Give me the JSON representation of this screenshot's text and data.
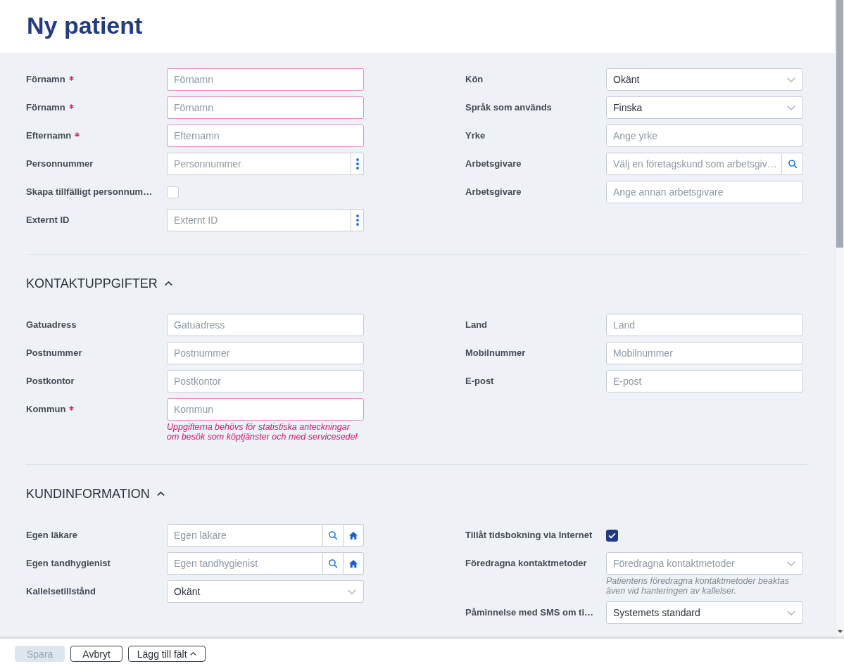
{
  "page": {
    "title": "Ny patient"
  },
  "sections": [
    {
      "left": [
        {
          "kind": "text",
          "label": "Förnamn",
          "required": true,
          "invalid": true,
          "placeholder": "Förnamn"
        },
        {
          "kind": "text",
          "label": "Förnamn",
          "required": true,
          "invalid": true,
          "placeholder": "Förnamn"
        },
        {
          "kind": "text",
          "label": "Efternamn",
          "required": true,
          "invalid": true,
          "placeholder": "Efternamn"
        },
        {
          "kind": "menu_input",
          "label": "Personnummer",
          "required": false,
          "invalid": false,
          "placeholder": "Personnummer"
        },
        {
          "kind": "checkbox",
          "label": "Skapa tillfälligt personnum…",
          "required": false,
          "checked": false
        },
        {
          "kind": "menu_input",
          "label": "Externt ID",
          "required": false,
          "invalid": false,
          "placeholder": "Externt ID"
        }
      ],
      "right": [
        {
          "kind": "select",
          "label": "Kön",
          "required": false,
          "invalid": false,
          "value": "Okänt"
        },
        {
          "kind": "select",
          "label": "Språk som används",
          "required": false,
          "invalid": false,
          "value": "Finska"
        },
        {
          "kind": "text",
          "label": "Yrke",
          "required": false,
          "invalid": false,
          "placeholder": "Ange yrke"
        },
        {
          "kind": "search",
          "label": "Arbetsgivare",
          "required": false,
          "invalid": false,
          "placeholder": "Välj en företagskund som arbetsgiv…"
        },
        {
          "kind": "text",
          "label": "Arbetsgivare",
          "required": false,
          "invalid": false,
          "placeholder": "Ange annan arbetsgivare"
        }
      ]
    },
    {
      "heading": "KONTAKTUPPGIFTER",
      "expanded": true,
      "left": [
        {
          "kind": "text",
          "label": "Gatuadress",
          "required": false,
          "invalid": false,
          "placeholder": "Gatuadress"
        },
        {
          "kind": "text",
          "label": "Postnummer",
          "required": false,
          "invalid": false,
          "placeholder": "Postnummer"
        },
        {
          "kind": "text",
          "label": "Postkontor",
          "required": false,
          "invalid": false,
          "placeholder": "Postkontor"
        },
        {
          "kind": "text",
          "label": "Kommun",
          "required": true,
          "invalid": true,
          "placeholder": "Kommun",
          "note": "Uppgifterna behövs för statistiska anteckningar om besök som köptjänster och med servicesedel"
        }
      ],
      "right": [
        {
          "kind": "text",
          "label": "Land",
          "required": false,
          "invalid": false,
          "placeholder": "Land"
        },
        {
          "kind": "text",
          "label": "Mobilnummer",
          "required": false,
          "invalid": false,
          "placeholder": "Mobilnummer"
        },
        {
          "kind": "text",
          "label": "E-post",
          "required": false,
          "invalid": false,
          "placeholder": "E-post"
        }
      ]
    },
    {
      "heading": "KUNDINFORMATION",
      "expanded": true,
      "left": [
        {
          "kind": "search_home",
          "label": "Egen läkare",
          "required": false,
          "invalid": false,
          "placeholder": "Egen läkare"
        },
        {
          "kind": "search_home",
          "label": "Egen tandhygienist",
          "required": false,
          "invalid": false,
          "placeholder": "Egen tandhygienist"
        },
        {
          "kind": "select",
          "label": "Kallelsetillstånd",
          "required": false,
          "invalid": false,
          "value": "Okänt"
        }
      ],
      "right": [
        {
          "kind": "checkbox",
          "label": "Tillåt tidsbokning via Internet",
          "required": false,
          "checked": true
        },
        {
          "kind": "select",
          "label": "Föredragna kontaktmetoder",
          "required": false,
          "invalid": false,
          "placeholder": "Föredragna kontaktmetoder",
          "note": "Patientens föredragna kontaktmetoder beaktas även vid hanteringen av kallelser."
        },
        {
          "kind": "select",
          "label": "Påminnelse med SMS om ti…",
          "required": false,
          "invalid": false,
          "value": "Systemets standard"
        }
      ]
    }
  ],
  "footer": {
    "buttons": [
      {
        "label": "Spara",
        "disabled": true,
        "kind": "plain"
      },
      {
        "label": "Avbryt",
        "disabled": false,
        "kind": "plain"
      },
      {
        "label": "Lägg till fält",
        "disabled": false,
        "kind": "menu"
      }
    ]
  }
}
